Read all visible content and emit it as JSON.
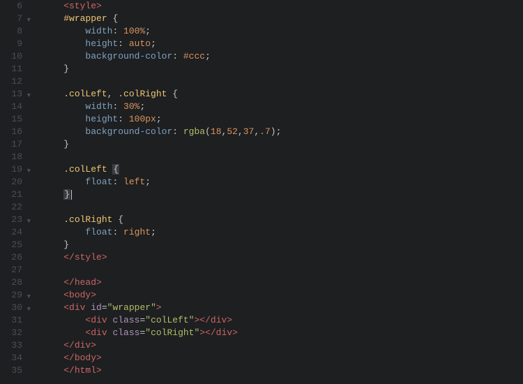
{
  "lines": [
    {
      "n": 6,
      "fold": false,
      "indent": 1,
      "tokens": [
        [
          "tag",
          "<style>"
        ]
      ]
    },
    {
      "n": 7,
      "fold": true,
      "indent": 1,
      "tokens": [
        [
          "sel",
          "#wrapper"
        ],
        [
          "punct",
          " {"
        ]
      ]
    },
    {
      "n": 8,
      "fold": false,
      "indent": 2,
      "tokens": [
        [
          "prop",
          "width"
        ],
        [
          "punct",
          ": "
        ],
        [
          "val",
          "100%"
        ],
        [
          "punct",
          ";"
        ]
      ]
    },
    {
      "n": 9,
      "fold": false,
      "indent": 2,
      "tokens": [
        [
          "prop",
          "height"
        ],
        [
          "punct",
          ": "
        ],
        [
          "val",
          "auto"
        ],
        [
          "punct",
          ";"
        ]
      ]
    },
    {
      "n": 10,
      "fold": false,
      "indent": 2,
      "tokens": [
        [
          "prop",
          "background-color"
        ],
        [
          "punct",
          ": "
        ],
        [
          "val",
          "#ccc"
        ],
        [
          "punct",
          ";"
        ]
      ]
    },
    {
      "n": 11,
      "fold": false,
      "indent": 1,
      "tokens": [
        [
          "punct",
          "}"
        ]
      ]
    },
    {
      "n": 12,
      "fold": false,
      "indent": 0,
      "tokens": []
    },
    {
      "n": 13,
      "fold": true,
      "indent": 1,
      "tokens": [
        [
          "sel",
          ".colLeft"
        ],
        [
          "punct",
          ", "
        ],
        [
          "sel",
          ".colRight"
        ],
        [
          "punct",
          " {"
        ]
      ]
    },
    {
      "n": 14,
      "fold": false,
      "indent": 2,
      "tokens": [
        [
          "prop",
          "width"
        ],
        [
          "punct",
          ": "
        ],
        [
          "val",
          "30%"
        ],
        [
          "punct",
          ";"
        ]
      ]
    },
    {
      "n": 15,
      "fold": false,
      "indent": 2,
      "tokens": [
        [
          "prop",
          "height"
        ],
        [
          "punct",
          ": "
        ],
        [
          "val",
          "100px"
        ],
        [
          "punct",
          ";"
        ]
      ]
    },
    {
      "n": 16,
      "fold": false,
      "indent": 2,
      "tokens": [
        [
          "prop",
          "background-color"
        ],
        [
          "punct",
          ": "
        ],
        [
          "func",
          "rgba"
        ],
        [
          "punct",
          "("
        ],
        [
          "val",
          "18"
        ],
        [
          "punct",
          ","
        ],
        [
          "val",
          "52"
        ],
        [
          "punct",
          ","
        ],
        [
          "val",
          "37"
        ],
        [
          "punct",
          ","
        ],
        [
          "val",
          ".7"
        ],
        [
          "punct",
          ");"
        ]
      ]
    },
    {
      "n": 17,
      "fold": false,
      "indent": 1,
      "tokens": [
        [
          "punct",
          "}"
        ]
      ]
    },
    {
      "n": 18,
      "fold": false,
      "indent": 0,
      "tokens": []
    },
    {
      "n": 19,
      "fold": true,
      "indent": 1,
      "tokens": [
        [
          "sel",
          ".colLeft"
        ],
        [
          "punct",
          " "
        ],
        [
          "hlbrace",
          "{"
        ]
      ]
    },
    {
      "n": 20,
      "fold": false,
      "indent": 2,
      "tokens": [
        [
          "prop",
          "float"
        ],
        [
          "punct",
          ": "
        ],
        [
          "val",
          "left"
        ],
        [
          "punct",
          ";"
        ]
      ]
    },
    {
      "n": 21,
      "fold": false,
      "indent": 1,
      "tokens": [
        [
          "hlbrace",
          "}"
        ],
        [
          "cursor",
          ""
        ]
      ]
    },
    {
      "n": 22,
      "fold": false,
      "indent": 0,
      "tokens": []
    },
    {
      "n": 23,
      "fold": true,
      "indent": 1,
      "tokens": [
        [
          "sel",
          ".colRight"
        ],
        [
          "punct",
          " {"
        ]
      ]
    },
    {
      "n": 24,
      "fold": false,
      "indent": 2,
      "tokens": [
        [
          "prop",
          "float"
        ],
        [
          "punct",
          ": "
        ],
        [
          "val",
          "right"
        ],
        [
          "punct",
          ";"
        ]
      ]
    },
    {
      "n": 25,
      "fold": false,
      "indent": 1,
      "tokens": [
        [
          "punct",
          "}"
        ]
      ]
    },
    {
      "n": 26,
      "fold": false,
      "indent": 1,
      "tokens": [
        [
          "tag",
          "</style>"
        ]
      ]
    },
    {
      "n": 27,
      "fold": false,
      "indent": 0,
      "tokens": []
    },
    {
      "n": 28,
      "fold": false,
      "indent": 1,
      "tokens": [
        [
          "tag",
          "</head>"
        ]
      ]
    },
    {
      "n": 29,
      "fold": true,
      "indent": 1,
      "tokens": [
        [
          "tag",
          "<body>"
        ]
      ]
    },
    {
      "n": 30,
      "fold": true,
      "indent": 1,
      "tokens": [
        [
          "tag",
          "<div "
        ],
        [
          "attr",
          "id"
        ],
        [
          "punct",
          "="
        ],
        [
          "str",
          "\"wrapper\""
        ],
        [
          "tag",
          ">"
        ]
      ]
    },
    {
      "n": 31,
      "fold": false,
      "indent": 2,
      "tokens": [
        [
          "tag",
          "<div "
        ],
        [
          "attr",
          "class"
        ],
        [
          "punct",
          "="
        ],
        [
          "str",
          "\"colLeft\""
        ],
        [
          "tag",
          "></div>"
        ]
      ]
    },
    {
      "n": 32,
      "fold": false,
      "indent": 2,
      "tokens": [
        [
          "tag",
          "<div "
        ],
        [
          "attr",
          "class"
        ],
        [
          "punct",
          "="
        ],
        [
          "str",
          "\"colRight\""
        ],
        [
          "tag",
          "></div>"
        ]
      ]
    },
    {
      "n": 33,
      "fold": false,
      "indent": 1,
      "tokens": [
        [
          "tag",
          "</div>"
        ]
      ]
    },
    {
      "n": 34,
      "fold": false,
      "indent": 1,
      "tokens": [
        [
          "tag",
          "</body>"
        ]
      ]
    },
    {
      "n": 35,
      "fold": false,
      "indent": 1,
      "tokens": [
        [
          "tag",
          "</html>"
        ]
      ]
    }
  ],
  "indent_unit": "    "
}
